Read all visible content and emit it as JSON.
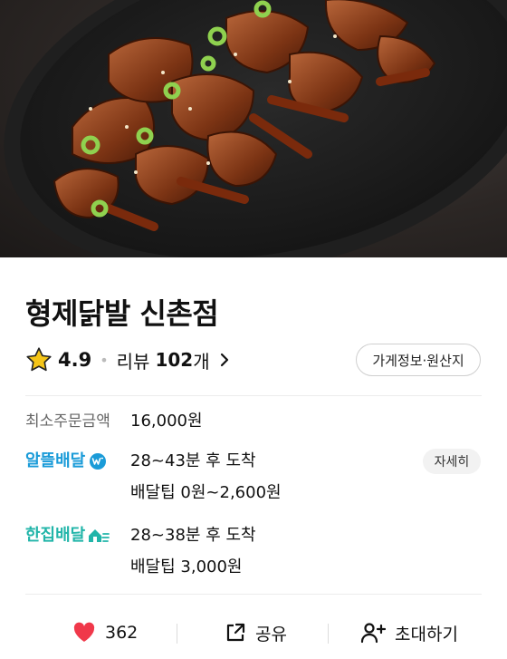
{
  "store": {
    "name": "형제닭발 신촌점",
    "rating": "4.9",
    "review_label": "리뷰",
    "review_count": "102",
    "review_unit": "개",
    "info_button": "가게정보·원산지"
  },
  "order": {
    "min_label": "최소주문금액",
    "min_value": "16,000원"
  },
  "delivery": {
    "saver": {
      "brand": "알뜰배달",
      "eta": "28~43분 후 도착",
      "tip": "배달팁 0원~2,600원",
      "detail_button": "자세히"
    },
    "single": {
      "brand": "한집배달",
      "eta": "28~38분 후 도착",
      "tip": "배달팁 3,000원"
    }
  },
  "actions": {
    "likes": "362",
    "share": "공유",
    "invite": "초대하기"
  },
  "colors": {
    "saver_brand": "#1a9bd8",
    "single_brand": "#21b5a9",
    "heart": "#f0384a",
    "star": "#f5c518"
  }
}
